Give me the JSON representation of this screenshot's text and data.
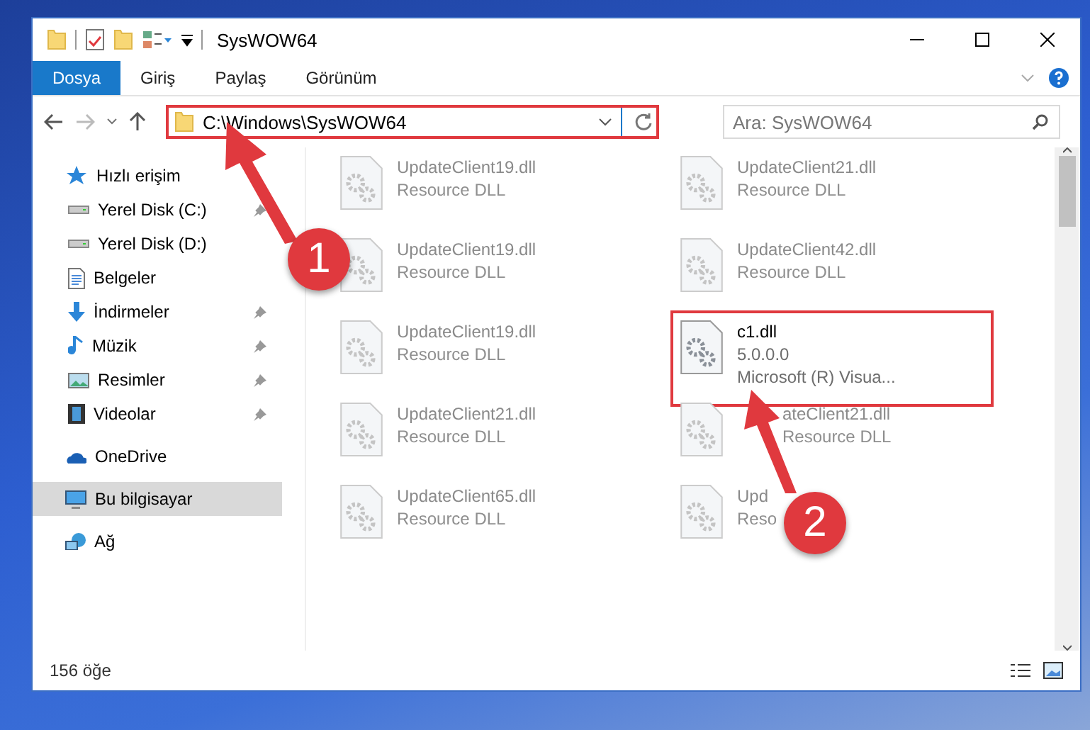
{
  "window": {
    "title": "SysWOW64"
  },
  "ribbon_tabs": [
    {
      "label": "Dosya",
      "selected": true
    },
    {
      "label": "Giriş",
      "selected": false
    },
    {
      "label": "Paylaş",
      "selected": false
    },
    {
      "label": "Görünüm",
      "selected": false
    }
  ],
  "address": {
    "value": "C:\\Windows\\SysWOW64"
  },
  "search": {
    "placeholder": "Ara: SysWOW64"
  },
  "sidebar": {
    "items": [
      {
        "label": "Hızlı erişim",
        "kind": "star",
        "selected": false,
        "children": [
          {
            "label": "Yerel Disk (C:)",
            "kind": "drive",
            "pinned": true,
            "selected": false
          },
          {
            "label": "Yerel Disk (D:)",
            "kind": "drive",
            "pinned": false,
            "selected": false
          },
          {
            "label": "Belgeler",
            "kind": "documents",
            "pinned": false,
            "selected": false
          },
          {
            "label": "İndirmeler",
            "kind": "download",
            "pinned": true,
            "selected": false
          },
          {
            "label": "Müzik",
            "kind": "music",
            "pinned": true,
            "selected": false
          },
          {
            "label": "Resimler",
            "kind": "pictures",
            "pinned": true,
            "selected": false
          },
          {
            "label": "Videolar",
            "kind": "video",
            "pinned": true,
            "selected": false
          }
        ]
      },
      {
        "label": "OneDrive",
        "kind": "cloud",
        "selected": false
      },
      {
        "label": "Bu bilgisayar",
        "kind": "computer",
        "selected": true
      },
      {
        "label": "Ağ",
        "kind": "network",
        "selected": false
      }
    ]
  },
  "files": [
    {
      "name": "UpdateClient19.dll",
      "details": [
        "Resource DLL"
      ],
      "blurred": true
    },
    {
      "name": "UpdateClient21.dll",
      "details": [
        "Resource DLL"
      ],
      "blurred": true
    },
    {
      "name": "UpdateClient19.dll",
      "details": [
        "Resource DLL"
      ],
      "blurred": true
    },
    {
      "name": "UpdateClient42.dll",
      "details": [
        "Resource DLL"
      ],
      "blurred": true
    },
    {
      "name": "UpdateClient19.dll",
      "details": [
        "Resource DLL"
      ],
      "blurred": true
    },
    {
      "name": "c1.dll",
      "details": [
        "5.0.0.0",
        "Microsoft (R) Visua..."
      ],
      "blurred": false
    },
    {
      "name": "UpdateClient21.dll",
      "details": [
        "Resource DLL"
      ],
      "blurred": true
    },
    {
      "name": "ateClient21.dll",
      "details": [
        "Resource DLL"
      ],
      "blurred": true
    },
    {
      "name": "UpdateClient65.dll",
      "details": [
        "Resource DLL"
      ],
      "blurred": true
    },
    {
      "name": "Upd",
      "details": [
        "Reso"
      ],
      "blurred": true
    }
  ],
  "annotations": [
    {
      "number": "1"
    },
    {
      "number": "2"
    }
  ],
  "status_bar": {
    "count": "156 öğe"
  }
}
